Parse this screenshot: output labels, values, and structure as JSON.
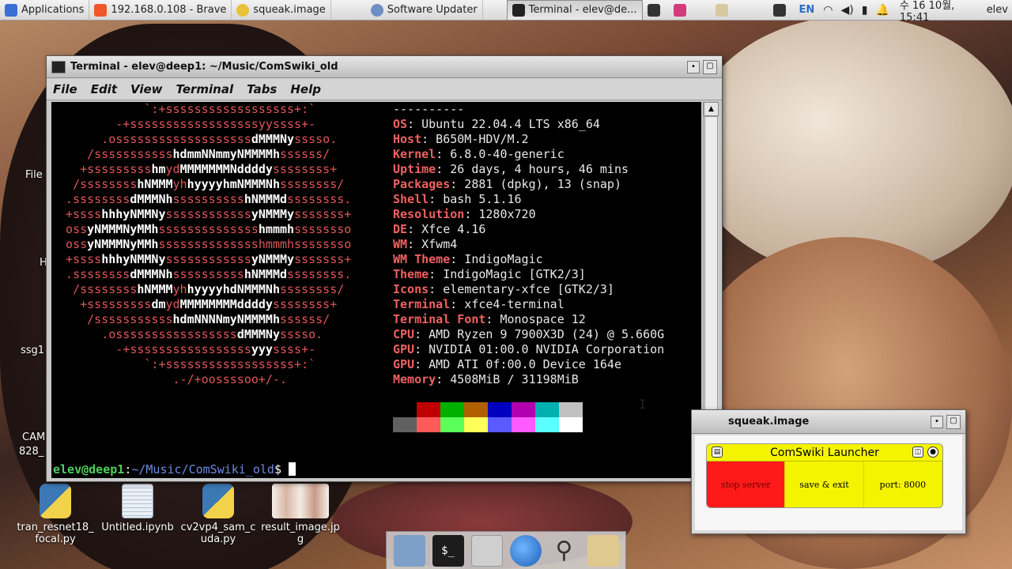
{
  "panel": {
    "applications_label": "Applications",
    "tasks": [
      {
        "label": "192.168.0.108 - Brave"
      },
      {
        "label": "squeak.image"
      },
      {
        "label": "Software Updater"
      },
      {
        "label": "Terminal - elev@de..."
      }
    ],
    "lang": "EN",
    "clock": "수 16 10월, 15:41",
    "user": "elev"
  },
  "desktop_icons": [
    {
      "label": "tran_resnet18_focal.py",
      "type": "python"
    },
    {
      "label": "Untitled.ipynb",
      "type": "notebook"
    },
    {
      "label": "cv2vp4_sam_cuda.py",
      "type": "python"
    },
    {
      "label": "result_image.jpg",
      "type": "image"
    }
  ],
  "left_labels": {
    "file": "File",
    "h": "H",
    "ssg": "ssg1",
    "cam1": "CAM",
    "cam2": "828_"
  },
  "terminal": {
    "title": "Terminal - elev@deep1: ~/Music/ComSwiki_old",
    "menu": [
      "File",
      "Edit",
      "View",
      "Terminal",
      "Tabs",
      "Help"
    ],
    "logo_lines": [
      [
        [
          "r",
          "             `:+ssssssssssssssssss+:`            "
        ]
      ],
      [
        [
          "r",
          "         -+ssssssssssssssssssyyssss+-        "
        ]
      ],
      [
        [
          "r",
          "       .osssssssssssssssssss"
        ],
        [
          "w",
          "dMMMNy"
        ],
        [
          "r",
          "sssso.      "
        ]
      ],
      [
        [
          "r",
          "     /sssssssssss"
        ],
        [
          "w",
          "hdmmNNmmyNMMMMh"
        ],
        [
          "r",
          "ssssss/     "
        ]
      ],
      [
        [
          "r",
          "    +sssssssss"
        ],
        [
          "w",
          "hm"
        ],
        [
          "r",
          "yd"
        ],
        [
          "w",
          "MMMMMMMNddddy"
        ],
        [
          "r",
          "ssssssss+    "
        ]
      ],
      [
        [
          "r",
          "   /ssssssss"
        ],
        [
          "w",
          "hNMMM"
        ],
        [
          "r",
          "yh"
        ],
        [
          "w",
          "hyyyyhmNMMMNh"
        ],
        [
          "r",
          "ssssssss/   "
        ]
      ],
      [
        [
          "r",
          "  .ssssssss"
        ],
        [
          "w",
          "dMMMNh"
        ],
        [
          "r",
          "ssssssssss"
        ],
        [
          "w",
          "hNMMMd"
        ],
        [
          "r",
          "ssssssss.  "
        ]
      ],
      [
        [
          "r",
          "  +ssss"
        ],
        [
          "w",
          "hhhyNMMNy"
        ],
        [
          "r",
          "ssssssssssss"
        ],
        [
          "w",
          "yNMMMy"
        ],
        [
          "r",
          "sssssss+  "
        ]
      ],
      [
        [
          "r",
          "  oss"
        ],
        [
          "w",
          "yNMMMNyMMh"
        ],
        [
          "r",
          "ssssssssssssss"
        ],
        [
          "w",
          "hmmmh"
        ],
        [
          "r",
          "ssssssso  "
        ]
      ],
      [
        [
          "r",
          "  oss"
        ],
        [
          "w",
          "yNMMMNyMMh"
        ],
        [
          "r",
          "sssssssssssssshmmmhssssssso  "
        ]
      ],
      [
        [
          "r",
          "  +ssss"
        ],
        [
          "w",
          "hhhyNMMNy"
        ],
        [
          "r",
          "ssssssssssss"
        ],
        [
          "w",
          "yNMMMy"
        ],
        [
          "r",
          "sssssss+  "
        ]
      ],
      [
        [
          "r",
          "  .ssssssss"
        ],
        [
          "w",
          "dMMMNh"
        ],
        [
          "r",
          "ssssssssss"
        ],
        [
          "w",
          "hNMMMd"
        ],
        [
          "r",
          "ssssssss.  "
        ]
      ],
      [
        [
          "r",
          "   /ssssssss"
        ],
        [
          "w",
          "hNMMM"
        ],
        [
          "r",
          "yh"
        ],
        [
          "w",
          "hyyyyhdNMMMNh"
        ],
        [
          "r",
          "ssssssss/   "
        ]
      ],
      [
        [
          "r",
          "    +sssssssss"
        ],
        [
          "w",
          "dm"
        ],
        [
          "r",
          "yd"
        ],
        [
          "w",
          "MMMMMMMMddddy"
        ],
        [
          "r",
          "ssssssss+    "
        ]
      ],
      [
        [
          "r",
          "     /sssssssssss"
        ],
        [
          "w",
          "hdmNNNNmyNMMMMh"
        ],
        [
          "r",
          "ssssss/     "
        ]
      ],
      [
        [
          "r",
          "       .osssssssssssssssss"
        ],
        [
          "w",
          "dMMMNy"
        ],
        [
          "r",
          "sssso.      "
        ]
      ],
      [
        [
          "r",
          "         -+sssssssssssssssss"
        ],
        [
          "w",
          "yyy"
        ],
        [
          "r",
          "ssss+-        "
        ]
      ],
      [
        [
          "r",
          "             `:+ssssssssssssssssss+:`            "
        ]
      ],
      [
        [
          "r",
          "                 .-/+oossssoo+/-.                "
        ]
      ]
    ],
    "info_header": "----------",
    "info": [
      {
        "k": "OS",
        "v": "Ubuntu 22.04.4 LTS x86_64"
      },
      {
        "k": "Host",
        "v": "B650M-HDV/M.2"
      },
      {
        "k": "Kernel",
        "v": "6.8.0-40-generic"
      },
      {
        "k": "Uptime",
        "v": "26 days, 4 hours, 46 mins"
      },
      {
        "k": "Packages",
        "v": "2881 (dpkg), 13 (snap)"
      },
      {
        "k": "Shell",
        "v": "bash 5.1.16"
      },
      {
        "k": "Resolution",
        "v": "1280x720"
      },
      {
        "k": "DE",
        "v": "Xfce 4.16"
      },
      {
        "k": "WM",
        "v": "Xfwm4"
      },
      {
        "k": "WM Theme",
        "v": "IndigoMagic"
      },
      {
        "k": "Theme",
        "v": "IndigoMagic [GTK2/3]"
      },
      {
        "k": "Icons",
        "v": "elementary-xfce [GTK2/3]"
      },
      {
        "k": "Terminal",
        "v": "xfce4-terminal"
      },
      {
        "k": "Terminal Font",
        "v": "Monospace 12"
      },
      {
        "k": "CPU",
        "v": "AMD Ryzen 9 7900X3D (24) @ 5.660G"
      },
      {
        "k": "GPU",
        "v": "NVIDIA 01:00.0 NVIDIA Corporation"
      },
      {
        "k": "GPU",
        "v": "AMD ATI 0f:00.0 Device 164e"
      },
      {
        "k": "Memory",
        "v": "4508MiB / 31198MiB"
      }
    ],
    "palette_row1": [
      "#000000",
      "#c00000",
      "#00b000",
      "#b06000",
      "#0000c0",
      "#b000b0",
      "#00b0b0",
      "#c0c0c0"
    ],
    "palette_row2": [
      "#606060",
      "#ff5a5a",
      "#5aff5a",
      "#ffff5a",
      "#5a5aff",
      "#ff5aff",
      "#5affff",
      "#ffffff"
    ],
    "prompt_user": "elev@deep1",
    "prompt_path": "~/Music/ComSwiki_old",
    "prompt_symbol": "$"
  },
  "squeak": {
    "title": "squeak.image",
    "launcher_title": "ComSwiki Launcher",
    "buttons": [
      "stop server",
      "save & exit",
      "port: 8000"
    ]
  }
}
